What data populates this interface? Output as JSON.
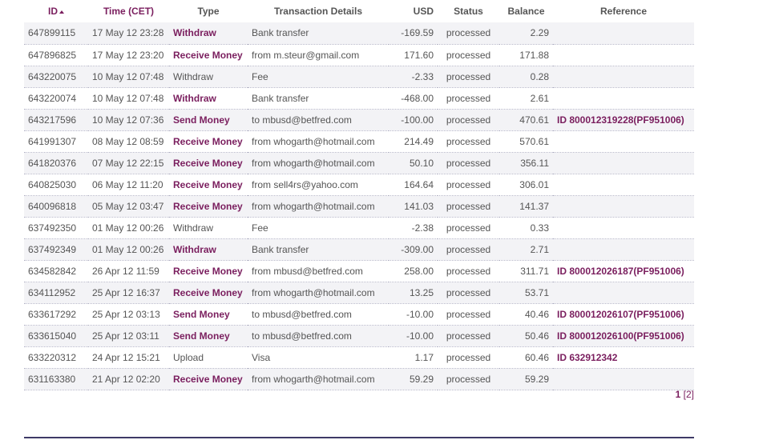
{
  "columns": {
    "id": "ID",
    "time": "Time (CET)",
    "type": "Type",
    "details": "Transaction Details",
    "usd": "USD",
    "status": "Status",
    "balance": "Balance",
    "reference": "Reference"
  },
  "rows": [
    {
      "id": "647899115",
      "time": "17 May 12 23:28",
      "type": "Withdraw",
      "type_link": true,
      "details": "Bank transfer",
      "usd": "-169.59",
      "status": "processed",
      "balance": "2.29",
      "reference": ""
    },
    {
      "id": "647896825",
      "time": "17 May 12 23:20",
      "type": "Receive Money",
      "type_link": true,
      "details": "from m.steur@gmail.com",
      "usd": "171.60",
      "status": "processed",
      "balance": "171.88",
      "reference": ""
    },
    {
      "id": "643220075",
      "time": "10 May 12 07:48",
      "type": "Withdraw",
      "type_link": false,
      "details": "Fee",
      "usd": "-2.33",
      "status": "processed",
      "balance": "0.28",
      "reference": ""
    },
    {
      "id": "643220074",
      "time": "10 May 12 07:48",
      "type": "Withdraw",
      "type_link": true,
      "details": "Bank transfer",
      "usd": "-468.00",
      "status": "processed",
      "balance": "2.61",
      "reference": ""
    },
    {
      "id": "643217596",
      "time": "10 May 12 07:36",
      "type": "Send Money",
      "type_link": true,
      "details": "to mbusd@betfred.com",
      "usd": "-100.00",
      "status": "processed",
      "balance": "470.61",
      "reference": "ID 800012319228(PF951006)"
    },
    {
      "id": "641991307",
      "time": "08 May 12 08:59",
      "type": "Receive Money",
      "type_link": true,
      "details": "from whogarth@hotmail.com",
      "usd": "214.49",
      "status": "processed",
      "balance": "570.61",
      "reference": ""
    },
    {
      "id": "641820376",
      "time": "07 May 12 22:15",
      "type": "Receive Money",
      "type_link": true,
      "details": "from whogarth@hotmail.com",
      "usd": "50.10",
      "status": "processed",
      "balance": "356.11",
      "reference": ""
    },
    {
      "id": "640825030",
      "time": "06 May 12 11:20",
      "type": "Receive Money",
      "type_link": true,
      "details": "from sell4rs@yahoo.com",
      "usd": "164.64",
      "status": "processed",
      "balance": "306.01",
      "reference": ""
    },
    {
      "id": "640096818",
      "time": "05 May 12 03:47",
      "type": "Receive Money",
      "type_link": true,
      "details": "from whogarth@hotmail.com",
      "usd": "141.03",
      "status": "processed",
      "balance": "141.37",
      "reference": ""
    },
    {
      "id": "637492350",
      "time": "01 May 12 00:26",
      "type": "Withdraw",
      "type_link": false,
      "details": "Fee",
      "usd": "-2.38",
      "status": "processed",
      "balance": "0.33",
      "reference": ""
    },
    {
      "id": "637492349",
      "time": "01 May 12 00:26",
      "type": "Withdraw",
      "type_link": true,
      "details": "Bank transfer",
      "usd": "-309.00",
      "status": "processed",
      "balance": "2.71",
      "reference": ""
    },
    {
      "id": "634582842",
      "time": "26 Apr 12 11:59",
      "type": "Receive Money",
      "type_link": true,
      "details": "from mbusd@betfred.com",
      "usd": "258.00",
      "status": "processed",
      "balance": "311.71",
      "reference": "ID 800012026187(PF951006)"
    },
    {
      "id": "634112952",
      "time": "25 Apr 12 16:37",
      "type": "Receive Money",
      "type_link": true,
      "details": "from whogarth@hotmail.com",
      "usd": "13.25",
      "status": "processed",
      "balance": "53.71",
      "reference": ""
    },
    {
      "id": "633617292",
      "time": "25 Apr 12 03:13",
      "type": "Send Money",
      "type_link": true,
      "details": "to mbusd@betfred.com",
      "usd": "-10.00",
      "status": "processed",
      "balance": "40.46",
      "reference": "ID 800012026107(PF951006)"
    },
    {
      "id": "633615040",
      "time": "25 Apr 12 03:11",
      "type": "Send Money",
      "type_link": true,
      "details": "to mbusd@betfred.com",
      "usd": "-10.00",
      "status": "processed",
      "balance": "50.46",
      "reference": "ID 800012026100(PF951006)"
    },
    {
      "id": "633220312",
      "time": "24 Apr 12 15:21",
      "type": "Upload",
      "type_link": false,
      "details": "Visa",
      "usd": "1.17",
      "status": "processed",
      "balance": "60.46",
      "reference": "ID 632912342"
    },
    {
      "id": "631163380",
      "time": "21 Apr 12 02:20",
      "type": "Receive Money",
      "type_link": true,
      "details": "from whogarth@hotmail.com",
      "usd": "59.29",
      "status": "processed",
      "balance": "59.29",
      "reference": ""
    }
  ],
  "pager": {
    "current": "1",
    "next": "[2]"
  },
  "colors": {
    "accent": "#7a1e5e",
    "row_alt": "#f3f3f6",
    "text": "#555555",
    "rule": "#3e3a66"
  }
}
